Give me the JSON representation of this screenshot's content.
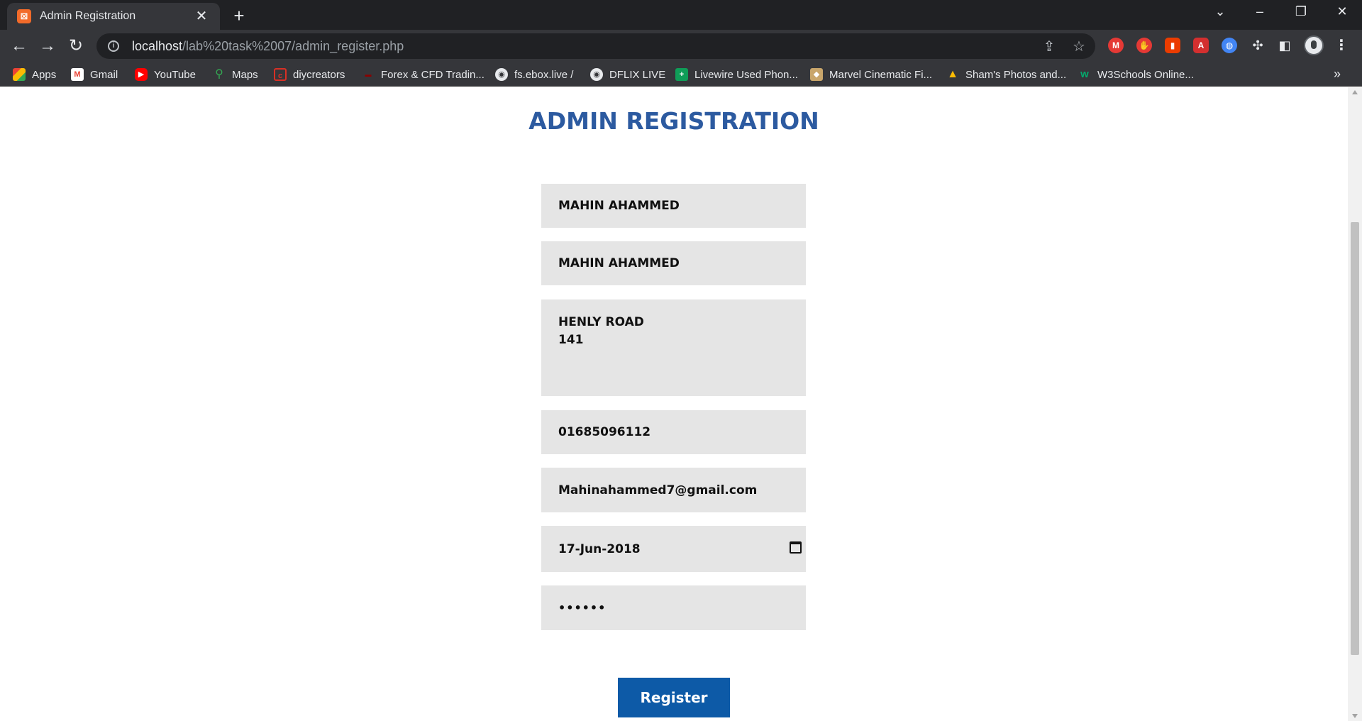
{
  "browser": {
    "tab_title": "Admin Registration",
    "favicon_letter": "⊠",
    "url_host": "localhost",
    "url_path": "/lab%20task%2007/admin_register.php"
  },
  "bookmarks": [
    {
      "label": "Apps",
      "icon": "apps-grid-icon",
      "color": "#ea4335"
    },
    {
      "label": "Gmail",
      "icon": "gmail-icon",
      "color": "#ea4335"
    },
    {
      "label": "YouTube",
      "icon": "youtube-icon",
      "color": "#ff0000"
    },
    {
      "label": "Maps",
      "icon": "maps-pin-icon",
      "color": "#34a853"
    },
    {
      "label": "diycreators",
      "icon": "diycreators-icon",
      "color": "#d93025"
    },
    {
      "label": "Forex & CFD Tradin...",
      "icon": "forex-icon",
      "color": "#8b0000"
    },
    {
      "label": "fs.ebox.live /",
      "icon": "globe-icon",
      "color": "#5f6368"
    },
    {
      "label": "DFLIX LIVE",
      "icon": "globe-icon",
      "color": "#5f6368"
    },
    {
      "label": "Livewire Used Phon...",
      "icon": "plus-icon",
      "color": "#0f9d58"
    },
    {
      "label": "Marvel Cinematic Fi...",
      "icon": "marvel-icon",
      "color": "#c9a66b"
    },
    {
      "label": "Sham's Photos and...",
      "icon": "drive-icon",
      "color": "#fbbc04"
    },
    {
      "label": "W3Schools Online...",
      "icon": "w3schools-icon",
      "color": "#04aa6d"
    }
  ],
  "form": {
    "heading": "ADMIN REGISTRATION",
    "name": "MAHIN AHAMMED",
    "username": "MAHIN AHAMMED",
    "address_line1": "HENLY ROAD",
    "address_line2": "141",
    "phone": "01685096112",
    "email": "Mahinahammed7@gmail.com",
    "dob": "17-Jun-2018",
    "password_mask": "••••••",
    "register_label": "Register"
  }
}
